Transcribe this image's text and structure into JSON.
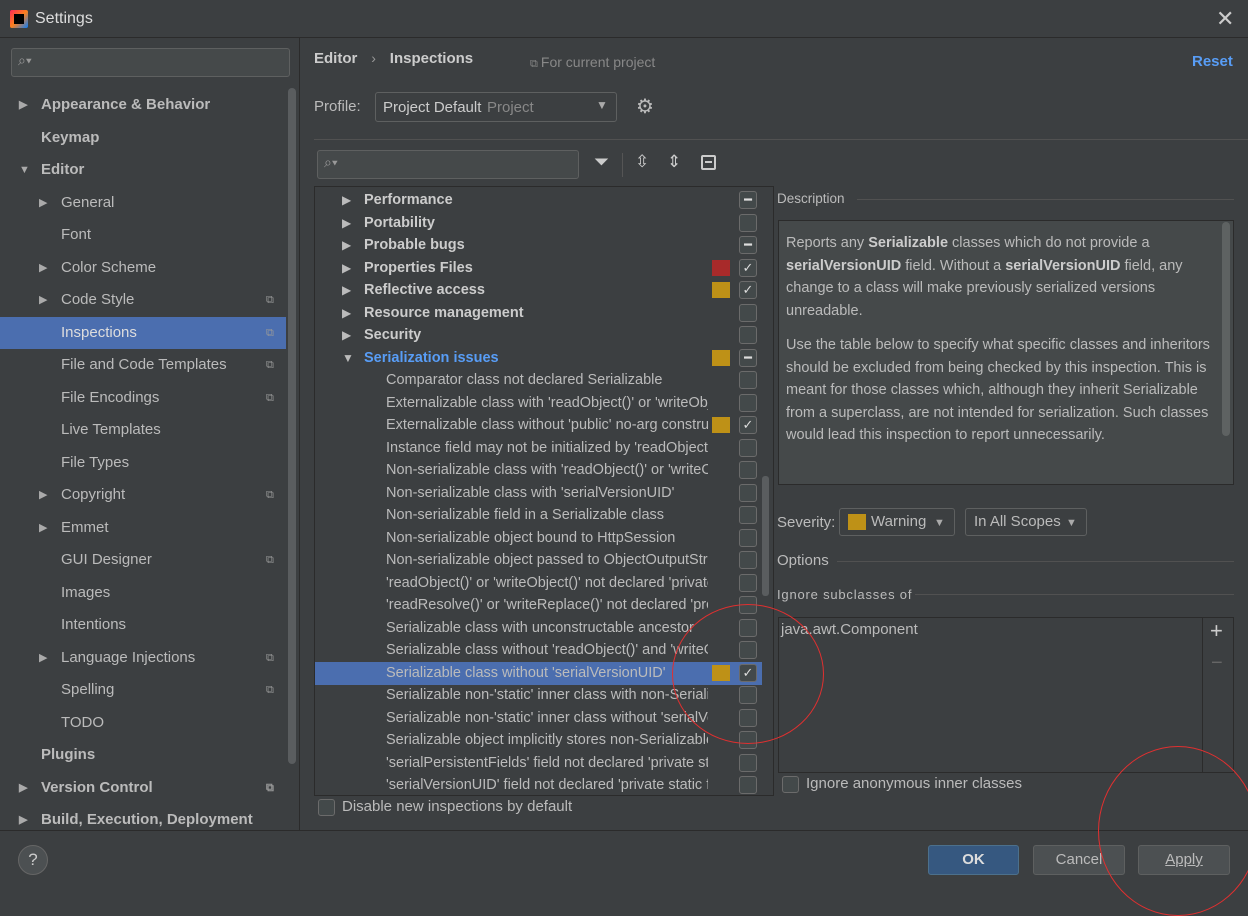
{
  "window": {
    "title": "Settings",
    "close_icon": "close-icon"
  },
  "sidebar": {
    "search_placeholder": "",
    "items": [
      {
        "label": "Appearance & Behavior",
        "level": 0,
        "arrow": "right",
        "bold": true
      },
      {
        "label": "Keymap",
        "level": 0,
        "bold": true
      },
      {
        "label": "Editor",
        "level": 0,
        "arrow": "down",
        "bold": true
      },
      {
        "label": "General",
        "level": 1,
        "arrow": "right"
      },
      {
        "label": "Font",
        "level": 1
      },
      {
        "label": "Color Scheme",
        "level": 1,
        "arrow": "right"
      },
      {
        "label": "Code Style",
        "level": 1,
        "arrow": "right",
        "project": true
      },
      {
        "label": "Inspections",
        "level": 1,
        "project": true,
        "selected": true
      },
      {
        "label": "File and Code Templates",
        "level": 1,
        "project": true
      },
      {
        "label": "File Encodings",
        "level": 1,
        "project": true
      },
      {
        "label": "Live Templates",
        "level": 1
      },
      {
        "label": "File Types",
        "level": 1
      },
      {
        "label": "Copyright",
        "level": 1,
        "arrow": "right",
        "project": true
      },
      {
        "label": "Emmet",
        "level": 1,
        "arrow": "right"
      },
      {
        "label": "GUI Designer",
        "level": 1,
        "project": true
      },
      {
        "label": "Images",
        "level": 1
      },
      {
        "label": "Intentions",
        "level": 1
      },
      {
        "label": "Language Injections",
        "level": 1,
        "arrow": "right",
        "project": true
      },
      {
        "label": "Spelling",
        "level": 1,
        "project": true
      },
      {
        "label": "TODO",
        "level": 1
      },
      {
        "label": "Plugins",
        "level": 0,
        "bold": true
      },
      {
        "label": "Version Control",
        "level": 0,
        "arrow": "right",
        "bold": true,
        "project": true
      },
      {
        "label": "Build, Execution, Deployment",
        "level": 0,
        "arrow": "right",
        "bold": true
      }
    ]
  },
  "header": {
    "breadcrumb": [
      "Editor",
      "Inspections"
    ],
    "breadcrumb_sep": "›",
    "scope_note": "For current project",
    "reset": "Reset"
  },
  "profile": {
    "label": "Profile:",
    "value": "Project Default",
    "type": "Project"
  },
  "tree": {
    "search_placeholder": "",
    "rows": [
      {
        "label": "Performance",
        "group": true,
        "state": "mixed"
      },
      {
        "label": "Portability",
        "group": true,
        "state": "off"
      },
      {
        "label": "Probable bugs",
        "group": true,
        "state": "mixed"
      },
      {
        "label": "Properties Files",
        "group": true,
        "state": "on",
        "severity": "#a82a2a"
      },
      {
        "label": "Reflective access",
        "group": true,
        "state": "on",
        "severity": "#be9117"
      },
      {
        "label": "Resource management",
        "group": true,
        "state": "off"
      },
      {
        "label": "Security",
        "group": true,
        "state": "off"
      },
      {
        "label": "Serialization issues",
        "group": true,
        "open": true,
        "state": "mixed",
        "severity": "#be9117"
      },
      {
        "label": "Comparator class not declared Serializable",
        "state": "off"
      },
      {
        "label": "Externalizable class with 'readObject()' or 'writeObject()'",
        "state": "off"
      },
      {
        "label": "Externalizable class without 'public' no-arg constructor",
        "state": "on",
        "severity": "#be9117"
      },
      {
        "label": "Instance field may not be initialized by 'readObject()'",
        "state": "off"
      },
      {
        "label": "Non-serializable class with 'readObject()' or 'writeObject()'",
        "state": "off"
      },
      {
        "label": "Non-serializable class with 'serialVersionUID'",
        "state": "off"
      },
      {
        "label": "Non-serializable field in a Serializable class",
        "state": "off"
      },
      {
        "label": "Non-serializable object bound to HttpSession",
        "state": "off"
      },
      {
        "label": "Non-serializable object passed to ObjectOutputStream",
        "state": "off"
      },
      {
        "label": "'readObject()' or 'writeObject()' not declared 'private'",
        "state": "off"
      },
      {
        "label": "'readResolve()' or 'writeReplace()' not declared 'protected'",
        "state": "off"
      },
      {
        "label": "Serializable class with unconstructable ancestor",
        "state": "off"
      },
      {
        "label": "Serializable class without 'readObject()' and 'writeObject()'",
        "state": "off"
      },
      {
        "label": "Serializable class without 'serialVersionUID'",
        "state": "on",
        "severity": "#be9117",
        "selected": true
      },
      {
        "label": "Serializable non-'static' inner class with non-Serializable outer class",
        "state": "off"
      },
      {
        "label": "Serializable non-'static' inner class without 'serialVersionUID'",
        "state": "off"
      },
      {
        "label": "Serializable object implicitly stores non-Serializable objects",
        "state": "off"
      },
      {
        "label": "'serialPersistentFields' field not declared 'private static final'",
        "state": "off"
      },
      {
        "label": "'serialVersionUID' field not declared 'private static final long'",
        "state": "off"
      }
    ]
  },
  "disable_new": {
    "label": "Disable new inspections by default",
    "checked": false
  },
  "description": {
    "title": "Description",
    "p1": [
      "Reports any ",
      {
        "b": "Serializable"
      },
      " classes which do not provide a ",
      {
        "b": "serialVersionUID"
      },
      " field. Without a ",
      {
        "b": "serialVersionUID"
      },
      " field, any change to a class will make previously serialized versions unreadable."
    ],
    "p2": "Use the table below to specify what specific classes and inheritors should be excluded from being checked by this inspection. This is meant for those classes which, although they inherit Serializable from a superclass, are not intended for serialization. Such classes would lead this inspection to report unnecessarily."
  },
  "severity": {
    "label": "Severity:",
    "value": "Warning",
    "color": "#be9117",
    "scope": "In All Scopes"
  },
  "options": {
    "title": "Options",
    "ignore_title": "Ignore subclasses of",
    "list": [
      "java.awt.Component"
    ],
    "add": "+",
    "remove": "−",
    "ignore_anon": "Ignore anonymous inner classes",
    "ignore_anon_checked": false
  },
  "footer": {
    "help": "?",
    "ok": "OK",
    "cancel": "Cancel",
    "apply": "Apply"
  },
  "colors": {
    "accent": "#589df6",
    "selection": "#4b6eaf",
    "ok_button": "#365880"
  }
}
